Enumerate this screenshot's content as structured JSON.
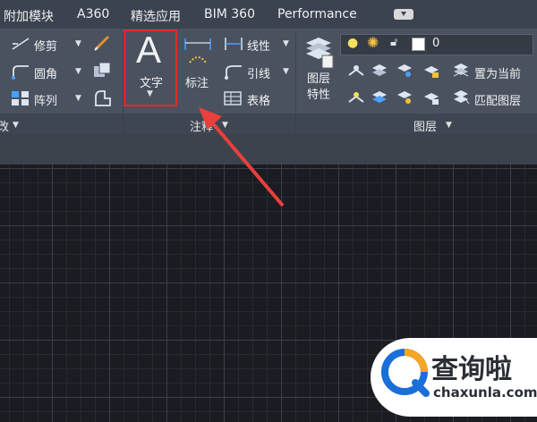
{
  "tabs": [
    "附加模块",
    "A360",
    "精选应用",
    "BIM 360",
    "Performance"
  ],
  "modify": {
    "trim_label": "修剪",
    "fillet_label": "圆角",
    "array_label": "阵列",
    "panel_title_partial": "改"
  },
  "annotation": {
    "text_label": "文字",
    "text_glyph": "A",
    "dimension_label": "标注",
    "linear_label": "线性",
    "leader_label": "引线",
    "table_label": "表格",
    "panel_title": "注释"
  },
  "layers": {
    "properties_label": "图层\n特性",
    "current_layer": "0",
    "set_current_label": "置为当前",
    "match_layer_label": "匹配图层",
    "panel_title": "图层"
  },
  "watermark": {
    "name": "查询啦",
    "url": "chaxunla.com"
  },
  "colors": {
    "highlight": "#e02a2a",
    "arrow": "#e8403c",
    "watermark_blue": "#1a6fd8",
    "watermark_orange": "#f5a623"
  }
}
